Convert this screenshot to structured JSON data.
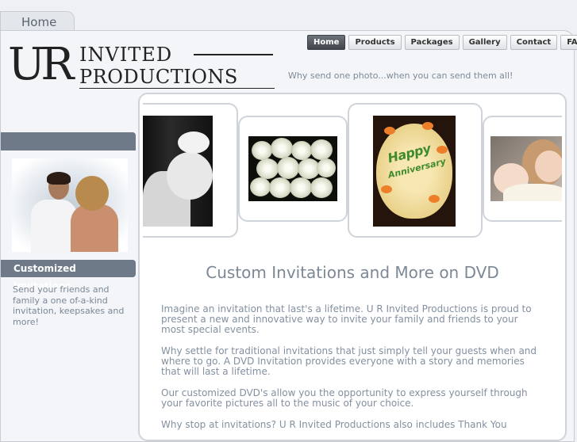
{
  "top_tab": {
    "label": "Home"
  },
  "logo": {
    "ur": "UR",
    "line1": "INVITED",
    "line2": "PRODUCTIONS"
  },
  "nav": {
    "items": [
      {
        "label": "Home",
        "active": true
      },
      {
        "label": "Products"
      },
      {
        "label": "Packages"
      },
      {
        "label": "Gallery"
      },
      {
        "label": "Contact"
      },
      {
        "label": "FAQ"
      }
    ]
  },
  "tagline": "Why send one photo...when you can send them all!",
  "sidebar": {
    "title": "Customized Invitations",
    "text": "Send your friends and family a one of-a-kind invitation, keepsakes and more!"
  },
  "gallery": {
    "cake_text_line1": "Happy",
    "cake_text_line2": "Anniversary"
  },
  "main": {
    "title": "Custom Invitations and More on DVD",
    "paragraphs": [
      "Imagine an invitation that last's a lifetime. U R Invited Productions is proud to present a new and innovative way to invite your family and friends to your most special events.",
      "Why settle for traditional invitations that just simply tell your guests when and where to go. A DVD Invitation provides everyone with a story and memories that will last a lifetime.",
      "Our customized DVD's allow you the opportunity to express yourself through your favorite pictures all to the music of your choice.",
      "Why stop at invitations? U R Invited Productions also includes Thank You"
    ]
  },
  "colors": {
    "sidebar_bar": "#6e7a88",
    "accent_text": "#7d8a99",
    "nav_active": "#40454b"
  }
}
